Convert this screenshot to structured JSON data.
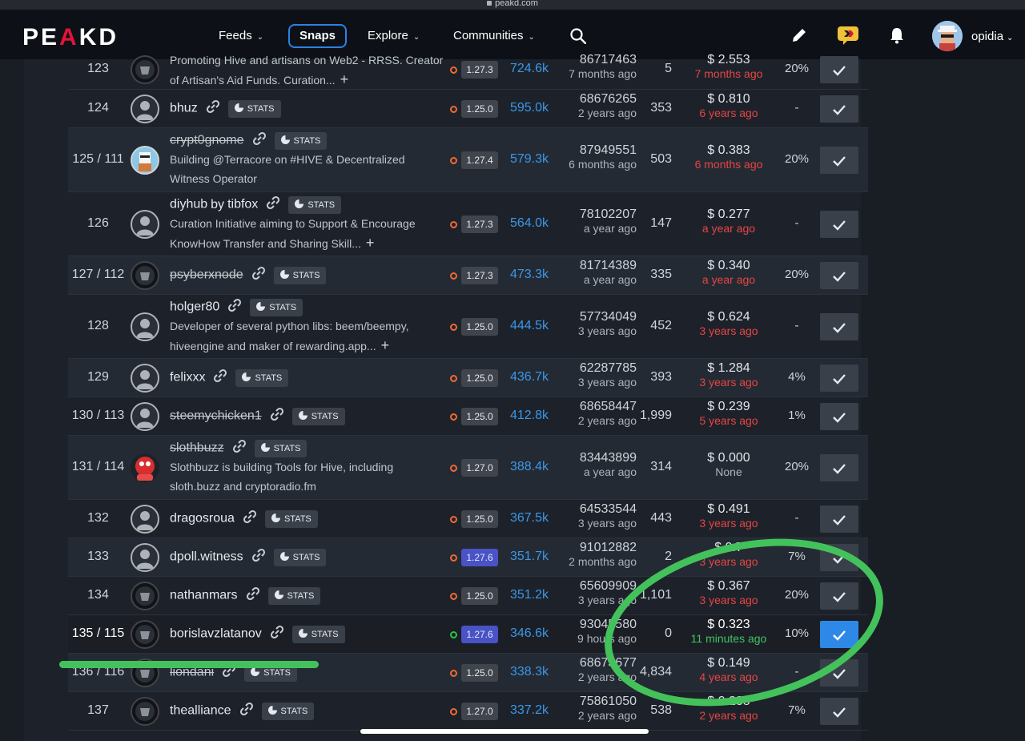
{
  "url": "peakd.com",
  "nav": {
    "logo_pre": "PE",
    "logo_a": "A",
    "logo_post": "KD",
    "feeds": "Feeds",
    "snaps": "Snaps",
    "explore": "Explore",
    "communities": "Communities",
    "username": "opidia"
  },
  "stats_label": "STATS",
  "rows": [
    {
      "rank": "123",
      "name": "",
      "desc": "Promoting Hive and artisans on Web2 - RRSS. Creator of Artisan's Aid Funds. Curation...",
      "version": "1.27.3",
      "hp": "724.6k",
      "block": "86717463",
      "block_ago": "7 months ago",
      "missed": "5",
      "price": "$ 2.553",
      "price_since": "7 months ago",
      "pct": "20%"
    },
    {
      "rank": "124",
      "name": "bhuz",
      "desc": "",
      "version": "1.25.0",
      "hp": "595.0k",
      "block": "68676265",
      "block_ago": "2 years ago",
      "missed": "353",
      "price": "$ 0.810",
      "price_since": "6 years ago",
      "pct": "-"
    },
    {
      "rank": "125 / 111",
      "name": "crypt0gnome",
      "desc": "Building @Terracore on #HIVE & Decentralized Witness Operator",
      "version": "1.27.4",
      "hp": "579.3k",
      "block": "87949551",
      "block_ago": "6 months ago",
      "missed": "503",
      "price": "$ 0.383",
      "price_since": "6 months ago",
      "pct": "20%"
    },
    {
      "rank": "126",
      "name": "diyhub",
      "by": "by",
      "by_name": "tibfox",
      "desc": "Curation Initiative aiming to Support & Encourage KnowHow Transfer and Sharing Skill...",
      "version": "1.27.3",
      "hp": "564.0k",
      "block": "78102207",
      "block_ago": "a year ago",
      "missed": "147",
      "price": "$ 0.277",
      "price_since": "a year ago",
      "pct": "-"
    },
    {
      "rank": "127 / 112",
      "name": "psyberxnode",
      "desc": "",
      "version": "1.27.3",
      "hp": "473.3k",
      "block": "81714389",
      "block_ago": "a year ago",
      "missed": "335",
      "price": "$ 0.340",
      "price_since": "a year ago",
      "pct": "20%"
    },
    {
      "rank": "128",
      "name": "holger80",
      "desc": "Developer of several python libs: beem/beempy, hiveengine and maker of rewarding.app...",
      "version": "1.25.0",
      "hp": "444.5k",
      "block": "57734049",
      "block_ago": "3 years ago",
      "missed": "452",
      "price": "$ 0.624",
      "price_since": "3 years ago",
      "pct": "-"
    },
    {
      "rank": "129",
      "name": "felixxx",
      "desc": "",
      "version": "1.25.0",
      "hp": "436.7k",
      "block": "62287785",
      "block_ago": "3 years ago",
      "missed": "393",
      "price": "$ 1.284",
      "price_since": "3 years ago",
      "pct": "4%"
    },
    {
      "rank": "130 / 113",
      "name": "steemychicken1",
      "desc": "",
      "version": "1.25.0",
      "hp": "412.8k",
      "block": "68658447",
      "block_ago": "2 years ago",
      "missed": "1,999",
      "price": "$ 0.239",
      "price_since": "5 years ago",
      "pct": "1%"
    },
    {
      "rank": "131 / 114",
      "name": "slothbuzz",
      "desc": "Slothbuzz is building Tools for Hive, including sloth.buzz and cryptoradio.fm",
      "version": "1.27.0",
      "hp": "388.4k",
      "block": "83443899",
      "block_ago": "a year ago",
      "missed": "314",
      "price": "$ 0.000",
      "price_since": "None",
      "pct": "20%"
    },
    {
      "rank": "132",
      "name": "dragosroua",
      "desc": "",
      "version": "1.25.0",
      "hp": "367.5k",
      "block": "64533544",
      "block_ago": "3 years ago",
      "missed": "443",
      "price": "$ 0.491",
      "price_since": "3 years ago",
      "pct": "-"
    },
    {
      "rank": "133",
      "name": "dpoll.witness",
      "desc": "",
      "version": "1.27.6",
      "hp": "351.7k",
      "block": "91012882",
      "block_ago": "2 months ago",
      "missed": "2",
      "price": "$ 0.7",
      "price_since": "3 years ago",
      "pct": "7%"
    },
    {
      "rank": "134",
      "name": "nathanmars",
      "desc": "",
      "version": "1.25.0",
      "hp": "351.2k",
      "block": "65609909",
      "block_ago": "3 years ago",
      "missed": "1,101",
      "price": "$ 0.367",
      "price_since": "3 years ago",
      "pct": "20%"
    },
    {
      "rank": "135 / 115",
      "name": "borislavzlatanov",
      "desc": "",
      "version": "1.27.6",
      "hp": "346.6k",
      "block": "93045580",
      "block_ago": "9 hours ago",
      "missed": "0",
      "price": "$ 0.323",
      "price_since": "11 minutes ago",
      "pct": "10%"
    },
    {
      "rank": "136 / 116",
      "name": "liondani",
      "desc": "",
      "version": "1.25.0",
      "hp": "338.3k",
      "block": "68673677",
      "block_ago": "2 years ago",
      "missed": "4,834",
      "price": "$ 0.149",
      "price_since": "4 years ago",
      "pct": "-"
    },
    {
      "rank": "137",
      "name": "thealliance",
      "desc": "",
      "version": "1.27.0",
      "hp": "337.2k",
      "block": "75861050",
      "block_ago": "2 years ago",
      "missed": "538",
      "price": "$ 0.288",
      "price_since": "2 years ago",
      "pct": "7%"
    }
  ]
}
